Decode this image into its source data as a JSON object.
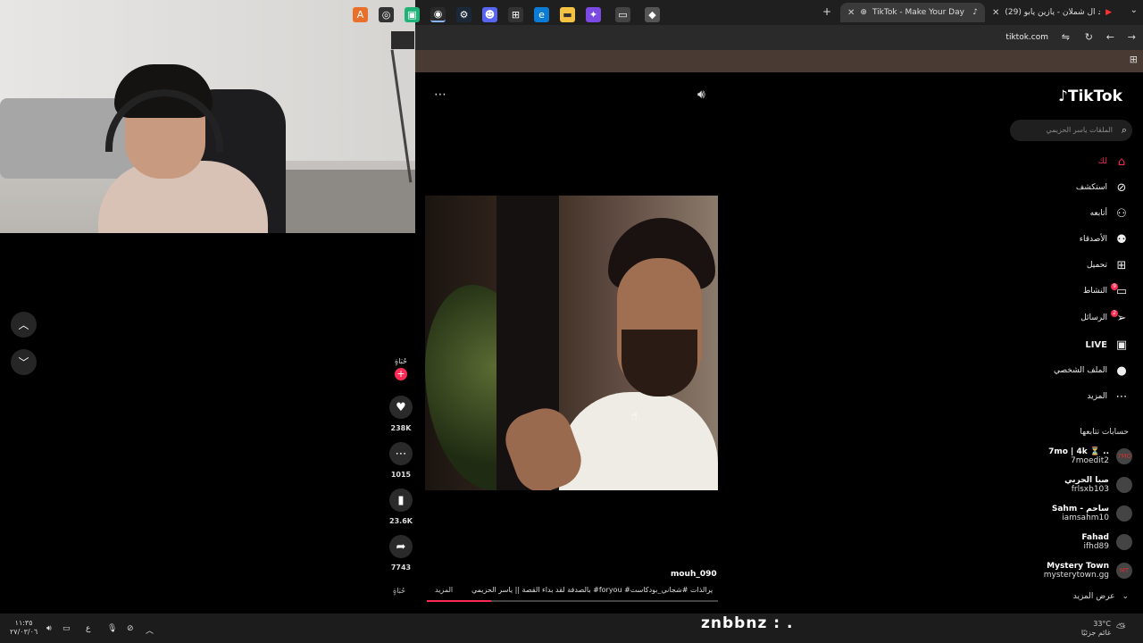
{
  "browser": {
    "tabs": [
      {
        "title": "TikTok - Make Your Day",
        "active": true
      },
      {
        "title": "(29) احمد ال شملان - يازين يابو",
        "active": false
      }
    ],
    "url": "tiktok.com"
  },
  "sidebar": {
    "logo": "TikTok",
    "search_placeholder": "الملقات ياسر الحزيمي",
    "items": [
      {
        "label": "لك",
        "icon": "⌂",
        "active": true
      },
      {
        "label": "استكشف",
        "icon": "⊘"
      },
      {
        "label": "أتابعه",
        "icon": "⚇"
      },
      {
        "label": "الأصدقاء",
        "icon": "⚉"
      },
      {
        "label": "تحميل",
        "icon": "⊞"
      },
      {
        "label": "النشاط",
        "icon": "▭",
        "badge": "9"
      },
      {
        "label": "الرسائل",
        "icon": "➢",
        "badge": "2"
      },
      {
        "label": "LIVE",
        "icon": "▣"
      },
      {
        "label": "الملف الشخصي",
        "icon": "●"
      },
      {
        "label": "المزيد",
        "icon": "⋯"
      }
    ],
    "following_title": "حسابات تتابعها",
    "following": [
      {
        "name": "7mo | 4k ⏳ ..",
        "handle": "7moedit2",
        "avatar": "7MO"
      },
      {
        "name": "صبا الحربي",
        "handle": "frlsxb103",
        "avatar": ""
      },
      {
        "name": "Sahm - ساحم",
        "handle": "iamsahm10",
        "avatar": ""
      },
      {
        "name": "Fahad",
        "handle": "ifhd89",
        "avatar": ""
      },
      {
        "name": "Mystery Town",
        "handle": "mysterytown.gg",
        "avatar": "MT"
      }
    ],
    "show_more": "عرض المزيد"
  },
  "video": {
    "username": "mouh_090",
    "caption": "بالصدفة لقد بداء القصة || ياسر الحزيمي #foryou #تطويرالذات #شجاني_بودكاست ...",
    "more_label": "المزيد",
    "progress": 0.22,
    "author_label": "حُبَاةٍ",
    "footer_label": "حُبَاةٍ",
    "likes": "238K",
    "comments": "1015",
    "saves": "23.6K",
    "shares": "7743"
  },
  "taskbar": {
    "time": "١١:٣٥",
    "date": "٢٧/٠٣/٠٦",
    "weather_temp": "33°C",
    "weather_desc": "غائم جزئيًا",
    "overlay": "znbbnz : ."
  },
  "colors": {
    "accent": "#fe2c55",
    "bg": "#000000",
    "tab_bar": "#1f1f1f"
  }
}
